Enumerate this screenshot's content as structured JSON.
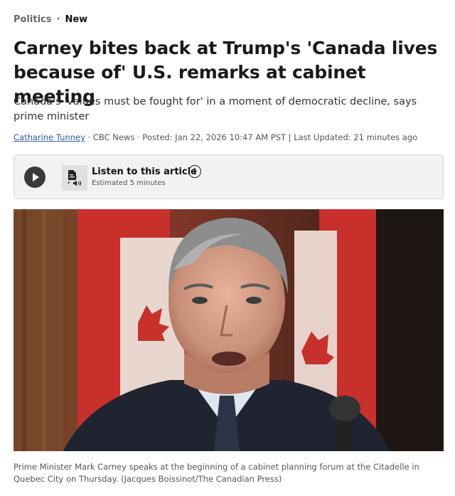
{
  "breadcrumb": {
    "section": "Politics",
    "separator": "·",
    "tag": "New"
  },
  "headline": "Carney bites back at Trump's 'Canada lives because of' U.S. remarks at cabinet meeting",
  "subheadline": "Canada's 'values must be fought for' in a moment of democratic decline, says prime minister",
  "byline": {
    "author": "Catharine Tunney",
    "rest": " · CBC News · Posted: Jan 22, 2026 10:47 AM PST | Last Updated: 21 minutes ago"
  },
  "listen": {
    "title": "Listen to this article",
    "estimate": "Estimated 5 minutes",
    "info_symbol": "i"
  },
  "photo": {
    "caption": "Prime Minister Mark Carney speaks at the beginning of a cabinet planning forum at the Citadelle in Quebec City on Thursday. (Jacques Boissinot/The Canadian Press)"
  },
  "colors": {
    "link": "#2e5aa8",
    "flag_red": "#c8302c",
    "box_bg": "#f2f2f2"
  }
}
